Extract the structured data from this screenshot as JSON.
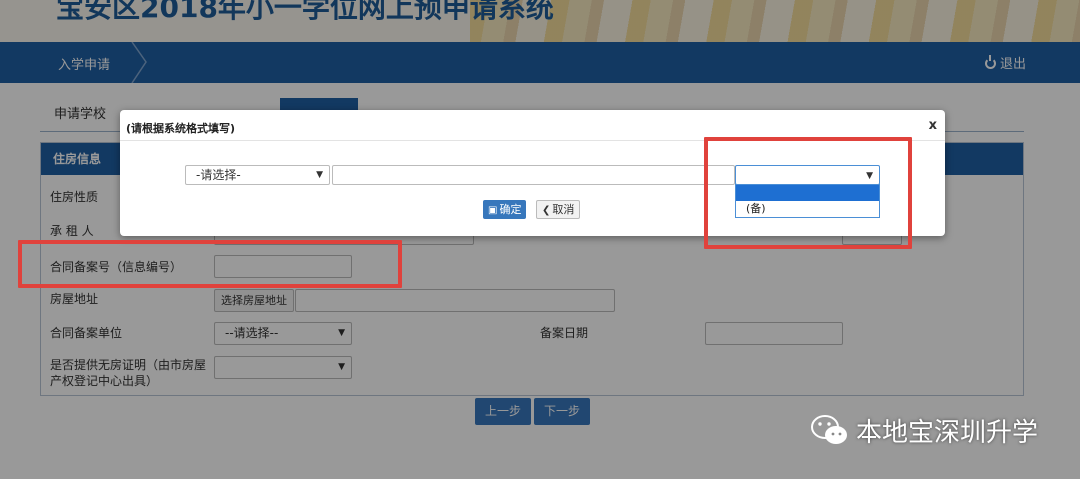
{
  "header": {
    "system_title": "宝安区2018年小一学位网上预申请系统",
    "nav_item": "入学申请",
    "logout": "退出"
  },
  "tabs": [
    "申请学校",
    "",
    "",
    "",
    ""
  ],
  "panel": {
    "title": "住房信息",
    "labels": {
      "housing_type": "住房性质",
      "tenant": "承 租 人",
      "contract_no": "合同备案号（信息编号）",
      "address": "房屋地址",
      "filing_unit": "合同备案单位",
      "filing_date": "备案日期",
      "no_house_proof": "是否提供无房证明（由市房屋产权登记中心出具）"
    },
    "choose_address_button": "选择房屋地址",
    "filing_unit_select": "--请选择--"
  },
  "steps": {
    "prev": "上一步",
    "next": "下一步"
  },
  "modal": {
    "title": "(请根据系统格式填写)",
    "close": "x",
    "select1_value": "-请选择-",
    "select2_value": "",
    "dropdown_options": [
      "",
      "(备)"
    ],
    "confirm": "确定",
    "cancel": "取消"
  },
  "watermark": {
    "text": "本地宝深圳升学"
  },
  "colors": {
    "primary": "#1f5fa3",
    "highlight": "#e0423c",
    "selected_option": "#1e6fd2"
  }
}
